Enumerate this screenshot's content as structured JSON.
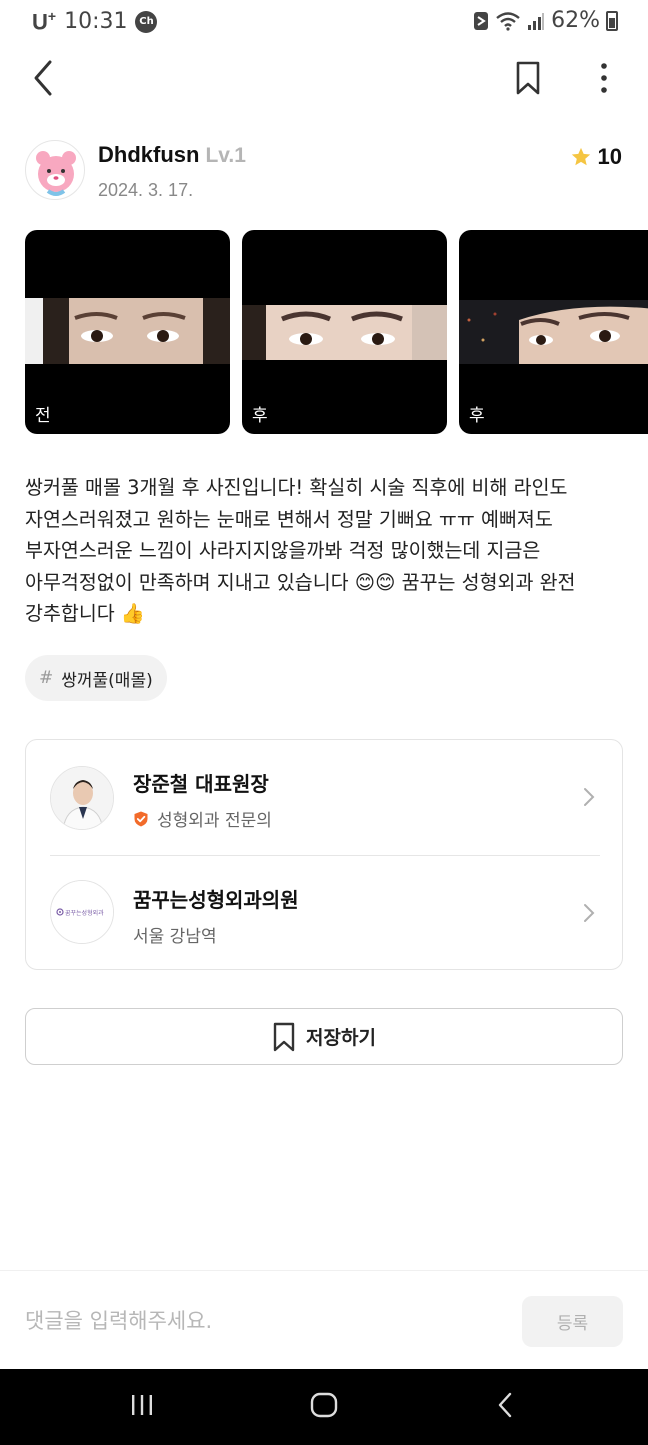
{
  "status_bar": {
    "carrier": "U",
    "carrier_sup": "+",
    "time": "10:31",
    "chat_badge": "Ch",
    "battery": "62%"
  },
  "author": {
    "name": "Dhdkfusn",
    "level": "Lv.1",
    "date": "2024. 3. 17.",
    "rating": "10"
  },
  "photos": [
    {
      "label": "전"
    },
    {
      "label": "후"
    },
    {
      "label": "후"
    }
  ],
  "post": {
    "body": "쌍커풀 매몰 3개월 후 사진입니다! 확실히 시술 직후에 비해 라인도\n자연스러워졌고 원하는 눈매로 변해서 정말 기뻐요 ㅠㅠ 예뻐져도\n부자연스러운 느낌이 사라지지않을까봐 걱정 많이했는데 지금은\n아무걱정없이 만족하며 지내고 있습니다 😊😊 꿈꾸는 성형외과 완전\n강추합니다 👍"
  },
  "tag": {
    "hash": "#",
    "label": "쌍꺼풀(매몰)"
  },
  "doctor": {
    "name": "장준철 대표원장",
    "specialty": "성형외과 전문의"
  },
  "clinic": {
    "name": "꿈꾸는성형외과의원",
    "location": "서울 강남역",
    "logo_text": "꿈꾸는성형외과"
  },
  "save_button": {
    "label": "저장하기"
  },
  "comment": {
    "placeholder": "댓글을 입력해주세요.",
    "submit_label": "등록"
  },
  "colors": {
    "star": "#F5C542",
    "verified_badge": "#F26B2A",
    "clinic_logo": "#7B5EA7"
  },
  "icons": {
    "back": "chevron-left-icon",
    "bookmark": "bookmark-icon",
    "more": "more-vertical-icon",
    "star": "star-icon",
    "verified": "verified-badge-icon",
    "chevron": "chevron-right-icon"
  }
}
